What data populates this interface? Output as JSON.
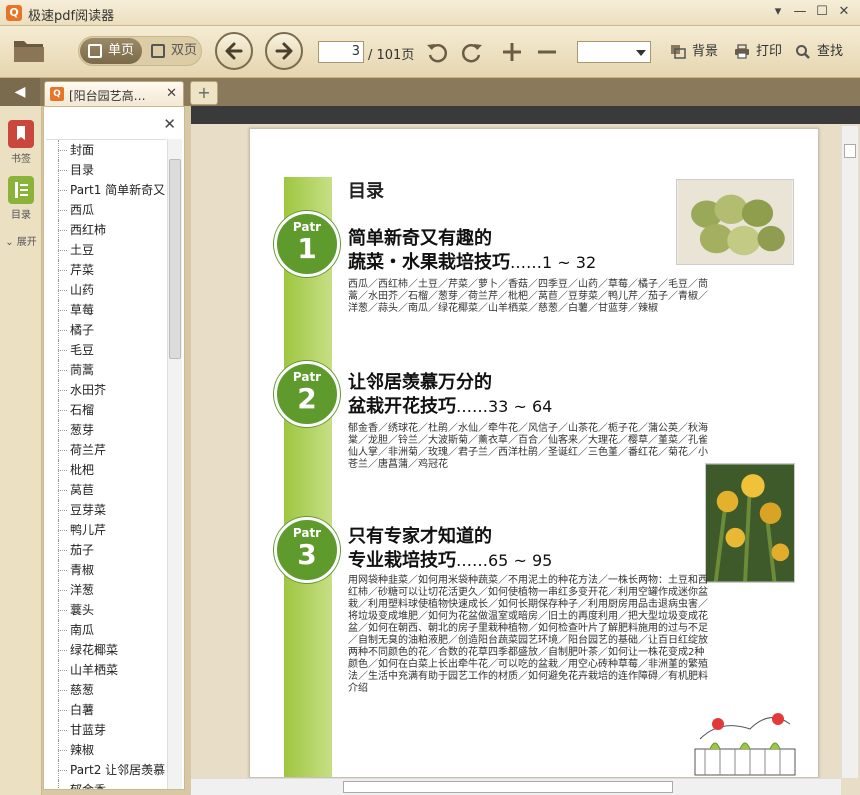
{
  "app": {
    "title": "极速pdf阅读器",
    "logo_glyph": "Q",
    "window_controls": [
      "▾",
      "—",
      "☐",
      "✕"
    ]
  },
  "toolbar": {
    "open_icon": "folder-icon",
    "single_page_label": "单页",
    "double_page_label": "双页",
    "current_page": "3",
    "total_pages": "/ 101页",
    "background_label": "背景",
    "print_label": "打印",
    "search_label": "查找",
    "zoom_value": ""
  },
  "tabs": {
    "collapse_glyph": "◀",
    "doc_tab_label": "[阳台园艺高…",
    "doc_tab_close": "✕",
    "new_tab": "+"
  },
  "rail": {
    "bookmark_label": "书签",
    "toc_label": "目录",
    "expand_label": "展开"
  },
  "outline": {
    "close": "✕",
    "items": [
      "封面",
      "目录",
      "Part1 简单新奇又有",
      "西瓜",
      "西红柿",
      "土豆",
      "芹菜",
      "山药",
      "草莓",
      "橘子",
      "毛豆",
      "茼蒿",
      "水田芥",
      "石榴",
      "葱芽",
      "荷兰芹",
      "枇杷",
      "莴苣",
      "豆芽菜",
      "鸭儿芹",
      "茄子",
      "青椒",
      "洋葱",
      "蘘头",
      "南瓜",
      "绿花椰菜",
      "山羊栖菜",
      "慈葱",
      "白薯",
      "甘蓝芽",
      "辣椒",
      "Part2 让邻居羡慕",
      "郁金香"
    ]
  },
  "page": {
    "toc_title": "目录",
    "parts": [
      {
        "label": "Patr",
        "number": "1",
        "heading_line1": "简单新奇又有趣的",
        "heading_line2": "蔬菜・水果栽培技巧",
        "range": "……1 ~ 32",
        "desc": "西瓜／西红柿／土豆／芹菜／萝卜／香菇／四季豆／山药／草莓／橘子／毛豆／茼蒿／水田芥／石榴／葱芽／荷兰芹／枇杷／莴苣／豆芽菜／鸭儿芹／茄子／青椒／洋葱／蒜头／南瓜／绿花椰菜／山羊栖菜／慈葱／白薯／甘蓝芽／辣椒"
      },
      {
        "label": "Patr",
        "number": "2",
        "heading_line1": "让邻居羡慕万分的",
        "heading_line2": "盆栽开花技巧",
        "range": "……33 ~ 64",
        "desc": "郁金香／绣球花／杜鹃／水仙／牵牛花／风信子／山茶花／栀子花／蒲公英／秋海棠／龙胆／铃兰／大波斯菊／薰衣草／百合／仙客来／大理花／樱草／堇菜／孔雀仙人掌／非洲菊／玫瑰／君子兰／西洋杜鹃／圣诞红／三色堇／番红花／菊花／小苍兰／唐菖蒲／鸡冠花"
      },
      {
        "label": "Patr",
        "number": "3",
        "heading_line1": "只有专家才知道的",
        "heading_line2": "专业栽培技巧",
        "range": "……65 ~ 95",
        "desc": "用网袋种韭菜／如何用米袋种蔬菜／不用泥土的种花方法／一株长两物：土豆和西红柿／砂糖可以让切花活更久／如何使植物一串红多变开花／利用空罐作成迷你盆栽／利用塑料球使植物快速成长／如何长期保存种子／利用厨房用品击退病虫害／将垃圾变成堆肥／如何为花盆做温室或暗房／旧土的再度利用／把大型垃圾变成花盆／如何在朝西、朝北的房子里栽种植物／如何检查叶片了解肥料施用的过与不足／自制无臭的油粕液肥／创造阳台蔬菜园艺环境／阳台园艺的基础／让百日红绽放两种不同颜色的花／合数的花草四季都盛放／自制肥叶茶／如何让一株花变成2种颜色／如何在白菜上长出牵牛花／可以吃的盆栽／用空心砖种草莓／非洲堇的繁殖法／生活中充满有助于园艺工作的材质／如何避免花卉栽培的连作障碍／有机肥料介绍"
      }
    ]
  },
  "colors": {
    "accent_green": "#5f9a2c",
    "band_green": "#9ec640",
    "chrome_tan": "#e6d6b0",
    "tab_brown": "#8a7a5b"
  }
}
